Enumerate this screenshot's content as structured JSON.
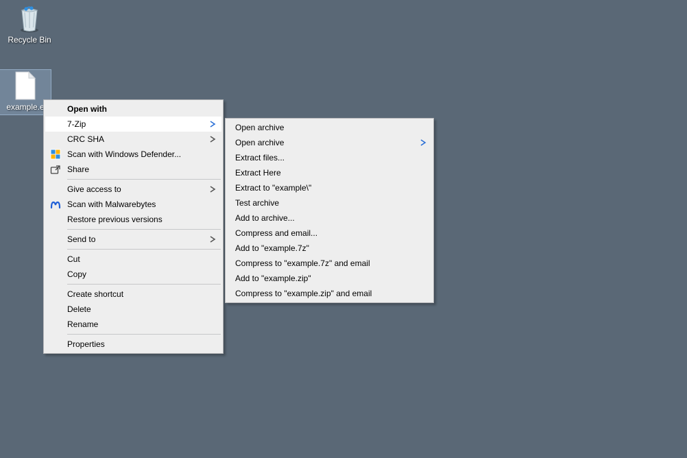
{
  "desktop": {
    "icons": [
      {
        "name": "recycle-bin",
        "label": "Recycle Bin"
      },
      {
        "name": "example-file",
        "label": "example.e"
      }
    ]
  },
  "context_menu": {
    "items": [
      {
        "label": "Open with",
        "bold": true
      },
      {
        "label": "7-Zip",
        "submenu": true,
        "hover": true
      },
      {
        "label": "CRC SHA",
        "submenu": true
      },
      {
        "label": "Scan with Windows Defender...",
        "icon": "shield"
      },
      {
        "label": "Share",
        "icon": "share"
      },
      {
        "label": "Give access to",
        "submenu": true
      },
      {
        "label": "Scan with Malwarebytes",
        "icon": "malwarebytes"
      },
      {
        "label": "Restore previous versions"
      },
      {
        "label": "Send to",
        "submenu": true
      },
      {
        "label": "Cut"
      },
      {
        "label": "Copy"
      },
      {
        "label": "Create shortcut"
      },
      {
        "label": "Delete"
      },
      {
        "label": "Rename"
      },
      {
        "label": "Properties"
      }
    ]
  },
  "submenu_7zip": {
    "items": [
      {
        "label": "Open archive"
      },
      {
        "label": "Open archive",
        "submenu": true
      },
      {
        "label": "Extract files..."
      },
      {
        "label": "Extract Here"
      },
      {
        "label": "Extract to \"example\\\""
      },
      {
        "label": "Test archive"
      },
      {
        "label": "Add to archive..."
      },
      {
        "label": "Compress and email..."
      },
      {
        "label": "Add to \"example.7z\""
      },
      {
        "label": "Compress to \"example.7z\" and email"
      },
      {
        "label": "Add to \"example.zip\""
      },
      {
        "label": "Compress to \"example.zip\" and email"
      }
    ]
  }
}
